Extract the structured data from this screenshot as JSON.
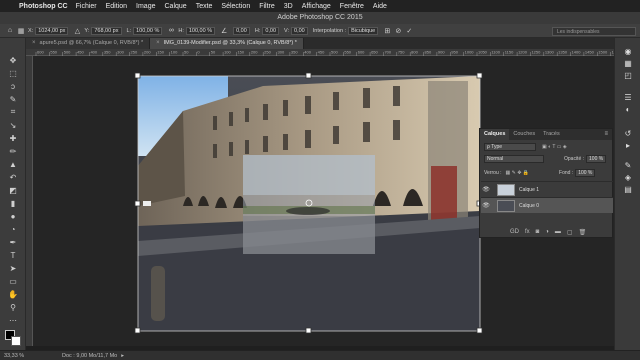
{
  "menubar": {
    "app": "Photoshop CC",
    "items": [
      "Fichier",
      "Edition",
      "Image",
      "Calque",
      "Texte",
      "Sélection",
      "Filtre",
      "3D",
      "Affichage",
      "Fenêtre",
      "Aide"
    ]
  },
  "window_title": "Adobe Photoshop CC 2015",
  "options": {
    "x_label": "X:",
    "x_value": "1024,00 px",
    "y_label": "Y:",
    "y_value": "768,00 px",
    "l_label": "L:",
    "l_value": "100,00 %",
    "h_label": "H:",
    "h_value": "100,00 %",
    "angle_value": "0,00",
    "hskew_label": "H:",
    "hskew_value": "0,00",
    "vskew_label": "V:",
    "vskew_value": "0,00",
    "interp_label": "Interpolation :",
    "interp_value": "Bicubique",
    "workspace": "Les indispensables"
  },
  "tabs": [
    {
      "label": "apure5.psd @ 66,7% (Calque 0, RVB/8*) *",
      "close": "×"
    },
    {
      "label": "IMG_0139-Modifier.psd @ 33,3% (Calque 0, RVB/8*) *",
      "close": "×"
    }
  ],
  "ruler_ticks": [
    "600",
    "550",
    "500",
    "450",
    "400",
    "350",
    "300",
    "250",
    "200",
    "150",
    "100",
    "50",
    "0",
    "50",
    "100",
    "150",
    "200",
    "250",
    "300",
    "350",
    "400",
    "450",
    "500",
    "550",
    "600",
    "650",
    "700",
    "750",
    "800",
    "850",
    "900",
    "950",
    "1000",
    "1050",
    "1100",
    "1150",
    "1200",
    "1250",
    "1300",
    "1350",
    "1400",
    "1450",
    "1500",
    "1550"
  ],
  "layers_panel": {
    "tabs": [
      "Calques",
      "Couches",
      "Tracés"
    ],
    "filter": "Type",
    "blend_mode": "Normal",
    "opacity_label": "Opacité :",
    "opacity_value": "100 %",
    "lock_label": "Verrou :",
    "fill_label": "Fond :",
    "fill_value": "100 %",
    "layers": [
      "Calque 1",
      "Calque 0"
    ],
    "bottom_icons": [
      "GD",
      "fx"
    ]
  },
  "status": {
    "zoom": "33,33 %",
    "doc": "Doc : 9,00 Mo/11,7 Mo"
  },
  "colors": {
    "accent_sky": "#a9c8e8",
    "ui_dark": "#3b3b3b"
  }
}
